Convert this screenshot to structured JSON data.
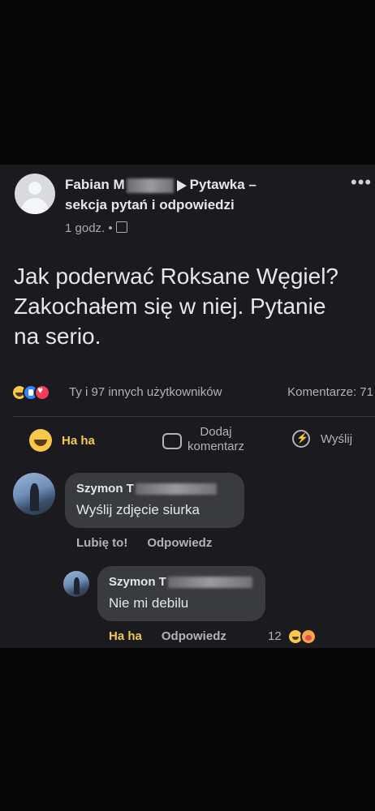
{
  "post": {
    "author_name": "Fabian M",
    "group_name_line1": "Pytawka –",
    "group_name_line2": "sekcja pytań i odpowiedzi",
    "time": "1 godz. •",
    "more_label": "•••",
    "text": "Jak poderwać Roksane Węgiel?\nZakochałem się w niej. Pytanie\nna serio.",
    "reactions_text": "Ty i 97 innych użytkowników",
    "comments_count": "Komentarze: 71"
  },
  "actions": {
    "haha_label": "Ha ha",
    "comment_label": "Dodaj komentarz",
    "send_label": "Wyślij"
  },
  "comments": [
    {
      "author": "Szymon T",
      "text": "Wyślij zdjęcie siurka",
      "like_label": "Lubię to!",
      "reply_label": "Odpowiedz"
    },
    {
      "author": "Szymon T",
      "text": "Nie mi debilu",
      "like_label": "Ha ha",
      "reply_label": "Odpowiedz",
      "reaction_count": "12"
    }
  ],
  "colors": {
    "background": "#070708",
    "post_background": "#1b1b1f",
    "bubble": "#3a3b3c",
    "haha_yellow": "#f2c94c",
    "text_secondary": "#b0b3b8"
  }
}
